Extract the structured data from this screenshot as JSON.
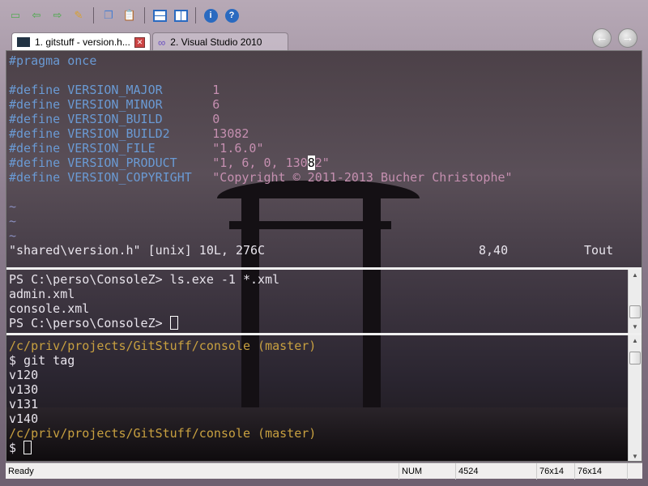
{
  "toolbar": {
    "items": [
      "new-tab-icon",
      "previous-tab-icon",
      "next-tab-icon",
      "rename-icon",
      "copy-icon",
      "paste-icon",
      "split-horizontal-icon",
      "split-vertical-icon",
      "info-icon",
      "help-icon"
    ]
  },
  "tabs": [
    {
      "label": "1. gitstuff - version.h...",
      "active": true
    },
    {
      "label": "2. Visual Studio 2010",
      "active": false
    }
  ],
  "vim": {
    "line1": "#pragma once",
    "defines": [
      {
        "kw": "#define",
        "name": "VERSION_MAJOR",
        "value": "1"
      },
      {
        "kw": "#define",
        "name": "VERSION_MINOR",
        "value": "6"
      },
      {
        "kw": "#define",
        "name": "VERSION_BUILD",
        "value": "0"
      },
      {
        "kw": "#define",
        "name": "VERSION_BUILD2",
        "value": "13082"
      },
      {
        "kw": "#define",
        "name": "VERSION_FILE",
        "value": "\"1.6.0\""
      },
      {
        "kw": "#define",
        "name": "VERSION_PRODUCT",
        "value_pre": "\"1, 6, 0, 130",
        "value_cursor": "8",
        "value_post": "2\""
      },
      {
        "kw": "#define",
        "name": "VERSION_COPYRIGHT",
        "value": "\"Copyright © 2011-2013 Bucher Christophe\""
      }
    ],
    "tilde": "~",
    "statusline": "\"shared\\version.h\" [unix] 10L, 276C",
    "position": "8,40",
    "scroll": "Tout"
  },
  "powershell": {
    "lines": [
      "PS C:\\perso\\ConsoleZ> ls.exe -1 *.xml",
      "admin.xml",
      "console.xml"
    ],
    "prompt": "PS C:\\perso\\ConsoleZ> "
  },
  "git": {
    "path1": "/c/priv/projects/GitStuff/console (master)",
    "cmd": "$ git tag",
    "tags": [
      "v120",
      "v130",
      "v131",
      "v140"
    ],
    "path2": "/c/priv/projects/GitStuff/console (master)",
    "prompt": "$ "
  },
  "status": {
    "ready": "Ready",
    "num": "NUM",
    "pid": "4524",
    "size1": "76x14",
    "size2": "76x14"
  },
  "colors": {
    "keyword": "#6a9ad4",
    "value": "#c58fb0",
    "git_path": "#c8a040"
  }
}
